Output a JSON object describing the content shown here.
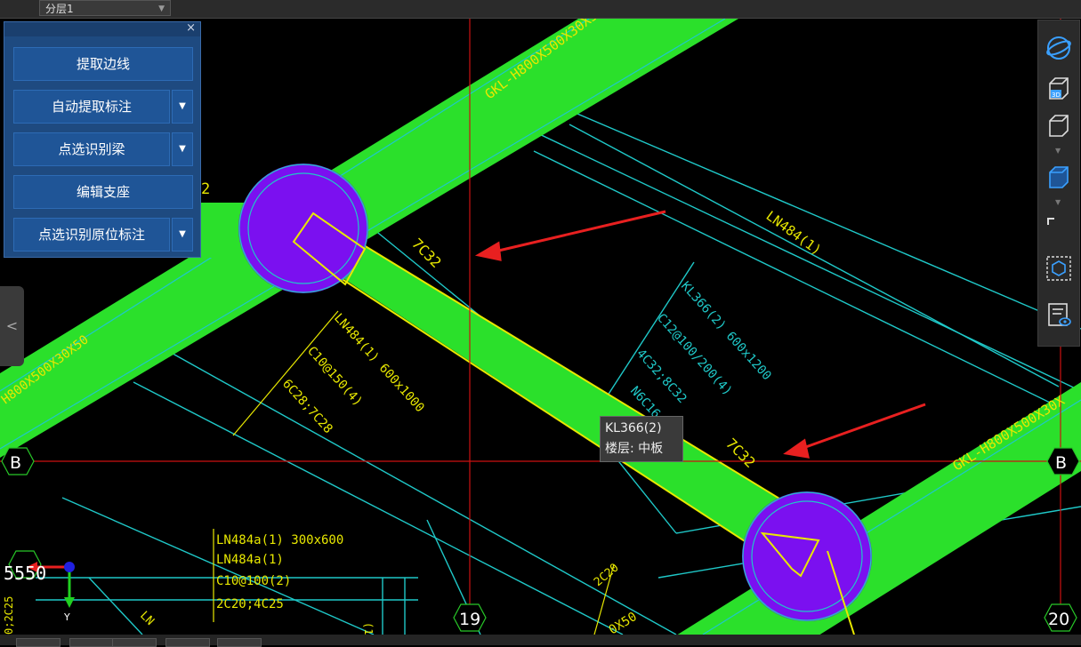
{
  "topbar": {
    "floor_select": "分层1"
  },
  "panel": {
    "close_label": "×",
    "buttons": [
      {
        "label": "提取边线",
        "dropdown": false
      },
      {
        "label": "自动提取标注",
        "dropdown": true
      },
      {
        "label": "点选识别梁",
        "dropdown": true
      },
      {
        "label": "编辑支座",
        "dropdown": false
      },
      {
        "label": "点选识别原位标注",
        "dropdown": true
      }
    ]
  },
  "toolbar": {
    "icons": [
      "orbit-icon",
      "view-3d-icon",
      "box-view-icon",
      "box-view-selected-icon",
      "fullscreen-icon",
      "layer-box-icon",
      "display-settings-icon"
    ],
    "label_3d": "3D"
  },
  "tooltip": {
    "line1": "KL366(2)",
    "line2": "楼层: 中板"
  },
  "sidetab": {
    "label": "<"
  },
  "cad": {
    "beam_upper_label": "GKL-H800X500X30X50",
    "beam_left_label": "H800X500X30X50",
    "beam_right_label": "GKL-H800X500X30X",
    "beam_bottom_label": "0X50",
    "label_2": "2",
    "label_7c32_top": "7C32",
    "label_7c32_mid": "7C32",
    "label_ln484_top": "LN484(1)",
    "ln484_annotation": [
      "LN484(1) 600x1000",
      "C10@150(4)",
      "6C28;7C28"
    ],
    "kl366_annotation": [
      "KL366(2) 600x1200",
      "C12@100/200(4)",
      "4C32;8C32",
      "N6C16"
    ],
    "ln484a_annotation": [
      "LN484a(1) 300x600",
      "LN484a(1)",
      "C10@100(2)",
      "2C20;4C25"
    ],
    "label_2c20": "2C20",
    "axis_b_left": "B",
    "axis_b_right": "B",
    "axis_19": "19",
    "axis_20": "20",
    "coord_left": "5550",
    "coord_vertical": "0;2C25",
    "ucs_y": "Y",
    "label_ln_bottom": "LN",
    "label_paren": "(1)"
  }
}
